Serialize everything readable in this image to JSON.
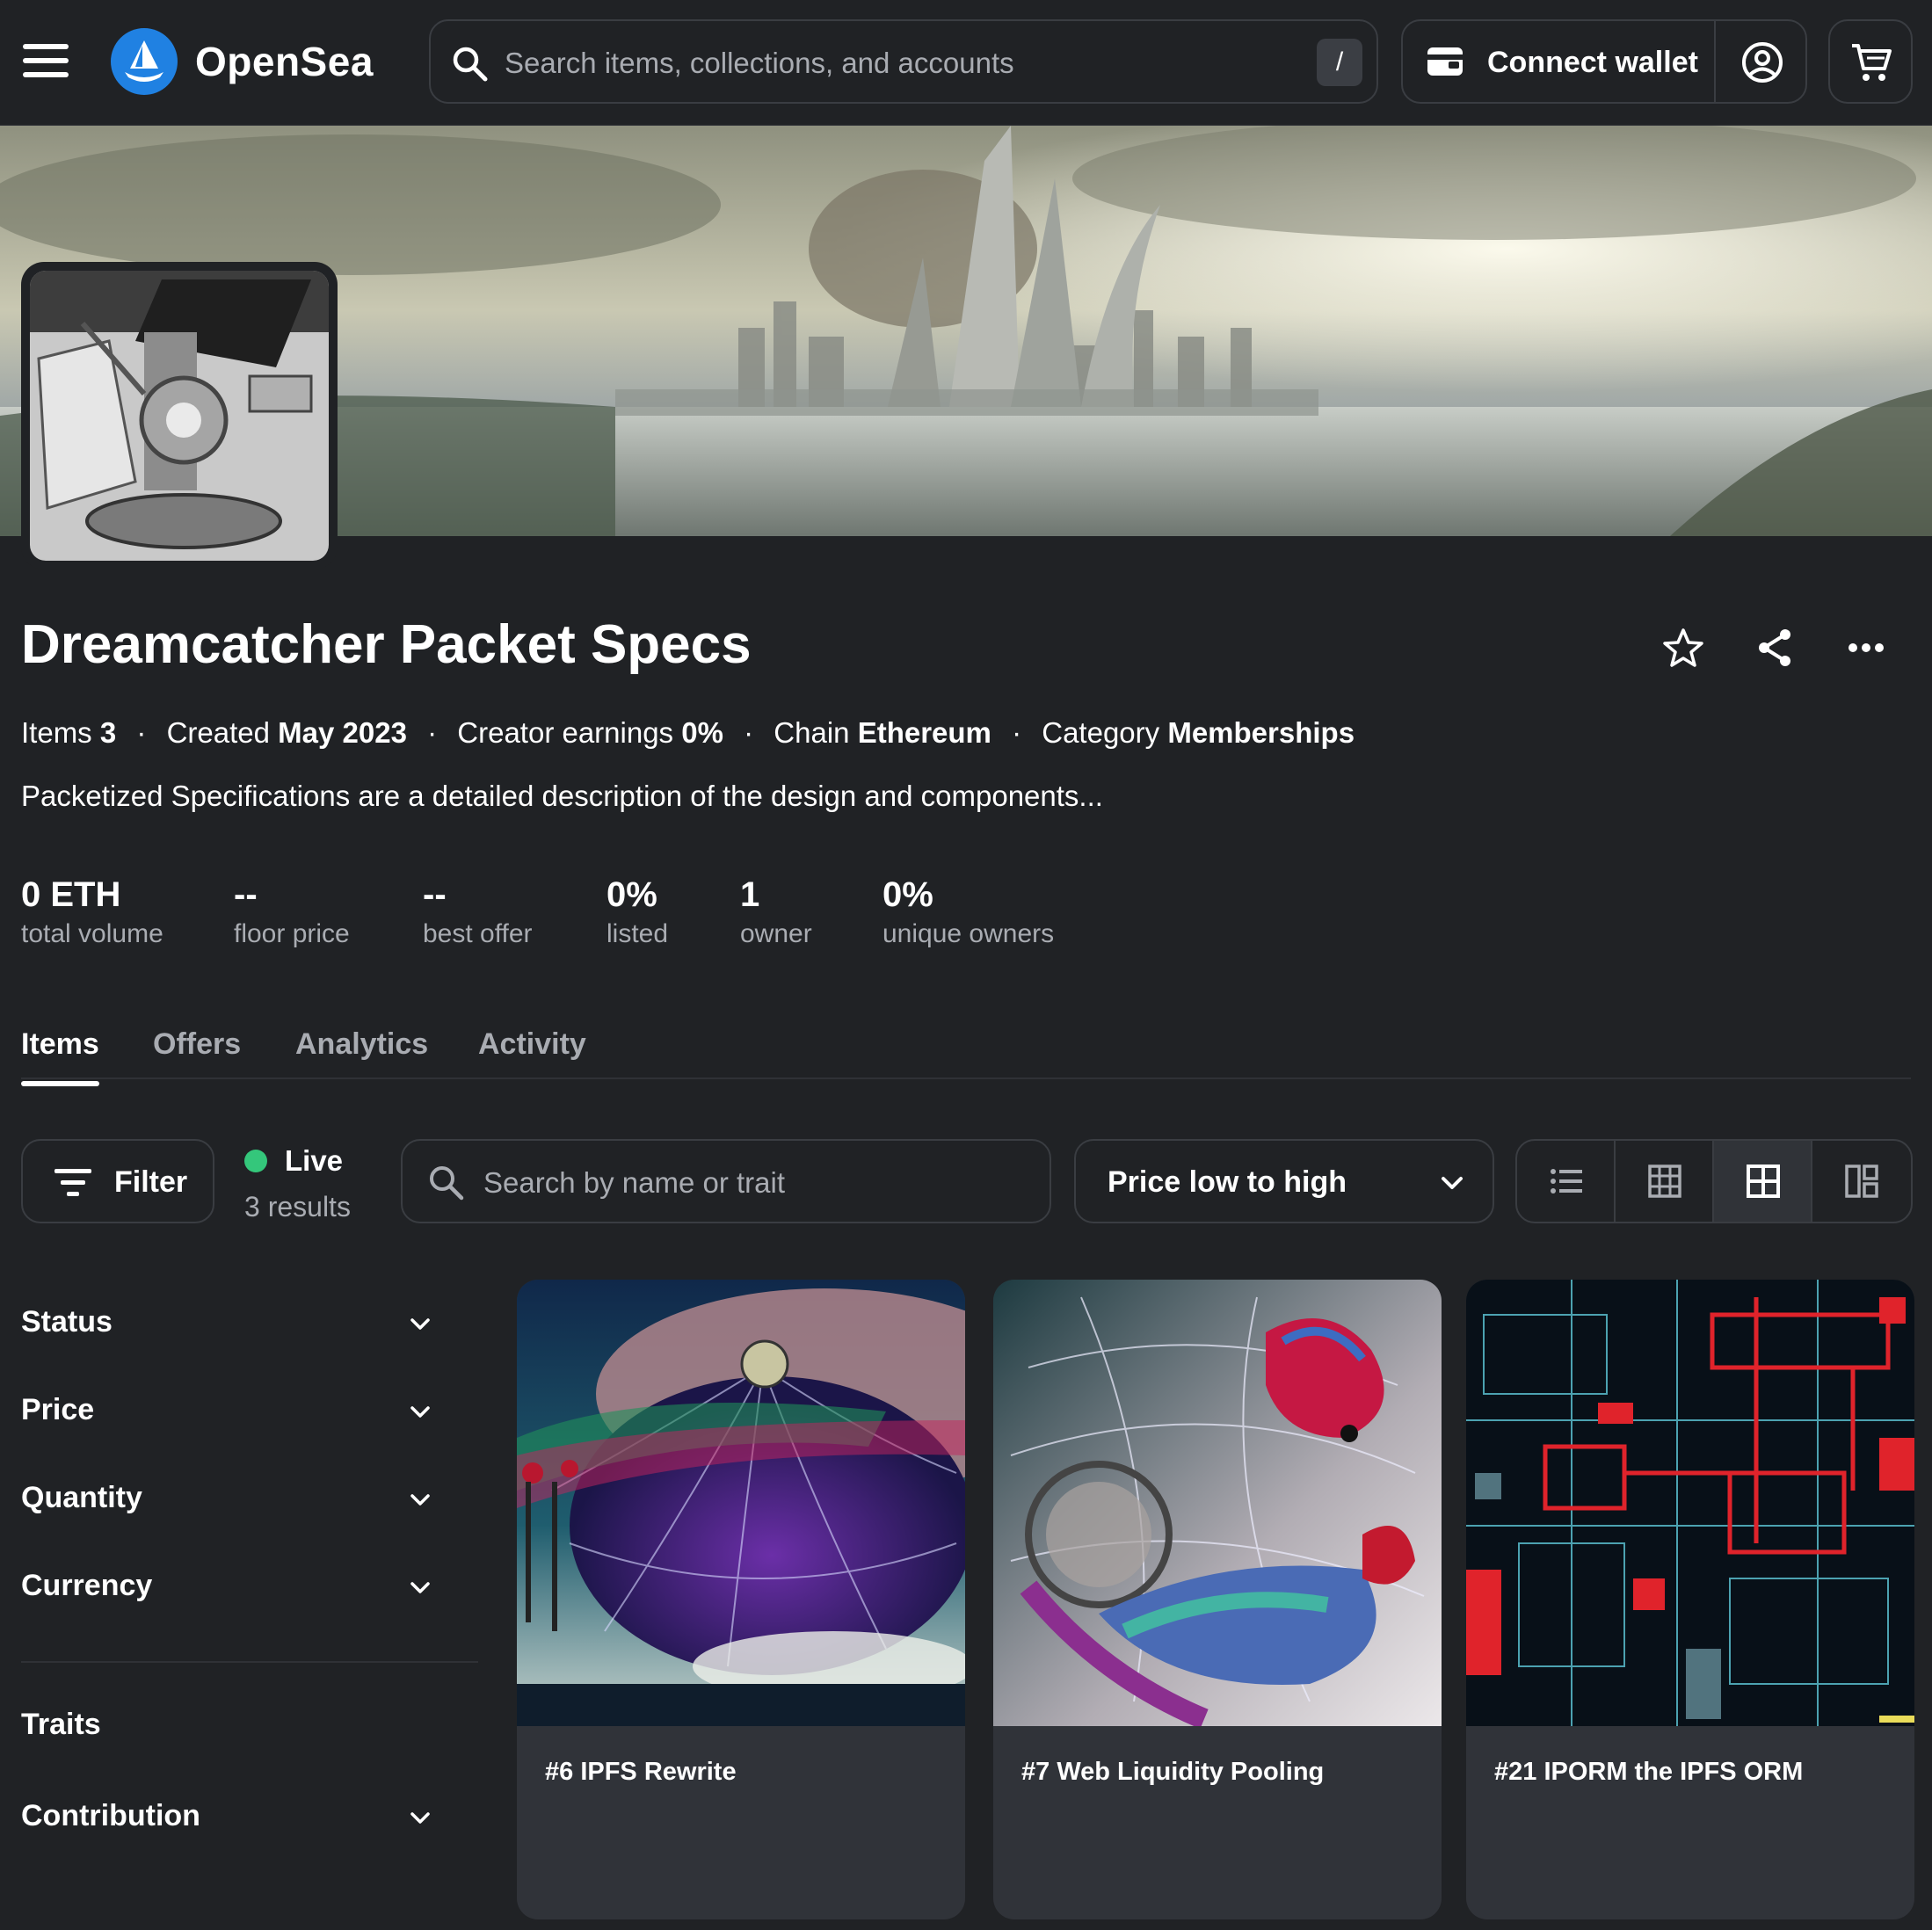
{
  "header": {
    "brand": "OpenSea",
    "search_placeholder": "Search items, collections, and accounts",
    "search_shortcut": "/",
    "connect_wallet_label": "Connect wallet",
    "icons": [
      "menu-icon",
      "opensea-logo-icon",
      "search-icon",
      "wallet-icon",
      "account-icon",
      "cart-icon"
    ]
  },
  "collection": {
    "title": "Dreamcatcher Packet Specs",
    "meta": {
      "items_label": "Items",
      "items_value": "3",
      "created_label": "Created",
      "created_value": "May 2023",
      "earnings_label": "Creator earnings",
      "earnings_value": "0%",
      "chain_label": "Chain",
      "chain_value": "Ethereum",
      "category_label": "Category",
      "category_value": "Memberships",
      "separator": "·"
    },
    "description": "Packetized Specifications are a detailed description of the design and components...",
    "stats": [
      {
        "value": "0 ETH",
        "label": "total volume"
      },
      {
        "value": "--",
        "label": "floor price"
      },
      {
        "value": "--",
        "label": "best offer"
      },
      {
        "value": "0%",
        "label": "listed"
      },
      {
        "value": "1",
        "label": "owner"
      },
      {
        "value": "0%",
        "label": "unique owners"
      }
    ],
    "action_icons": [
      "star-icon",
      "share-icon",
      "more-icon"
    ]
  },
  "tabs": [
    {
      "label": "Items",
      "active": true
    },
    {
      "label": "Offers",
      "active": false
    },
    {
      "label": "Analytics",
      "active": false
    },
    {
      "label": "Activity",
      "active": false
    }
  ],
  "toolbar": {
    "filter_label": "Filter",
    "live_label": "Live",
    "results_label": "3 results",
    "search_placeholder": "Search by name or trait",
    "sort_label": "Price low to high",
    "view_modes": [
      "list-view-icon",
      "grid-small-icon",
      "grid-large-icon",
      "masonry-view-icon"
    ],
    "active_view": "grid-large-icon"
  },
  "sidebar": {
    "filters": [
      {
        "label": "Status",
        "has_chevron": true
      },
      {
        "label": "Price",
        "has_chevron": true
      },
      {
        "label": "Quantity",
        "has_chevron": true
      },
      {
        "label": "Currency",
        "has_chevron": true
      }
    ],
    "traits_heading": "Traits",
    "trait_filters": [
      {
        "label": "Contribution",
        "has_chevron": true
      }
    ]
  },
  "items": [
    {
      "name": "#6 IPFS Rewrite"
    },
    {
      "name": "#7 Web Liquidity Pooling"
    },
    {
      "name": "#21 IPORM the IPFS ORM"
    }
  ],
  "colors": {
    "background": "#202225",
    "card": "#303339",
    "border": "#3a3d42",
    "accent_blue": "#2081e2",
    "live_green": "#34c77b",
    "muted_text": "#a9acb2"
  }
}
